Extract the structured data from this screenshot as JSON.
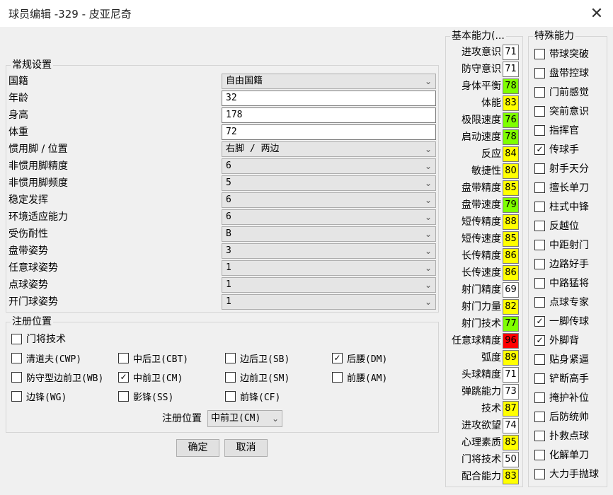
{
  "window": {
    "title": "球员编辑 -329 - 皮亚尼奇",
    "close_glyph": "✕"
  },
  "general": {
    "title": "常规设置",
    "rows": [
      {
        "label": "国籍",
        "value": "自由国籍",
        "kind": "select"
      },
      {
        "label": "年龄",
        "value": "32",
        "kind": "text"
      },
      {
        "label": "身高",
        "value": "178",
        "kind": "text"
      },
      {
        "label": "体重",
        "value": "72",
        "kind": "text"
      },
      {
        "label": "惯用脚 / 位置",
        "value": "右脚 / 两边",
        "kind": "select"
      },
      {
        "label": "非惯用脚精度",
        "value": "6",
        "kind": "select"
      },
      {
        "label": "非惯用脚频度",
        "value": "5",
        "kind": "select"
      },
      {
        "label": "稳定发挥",
        "value": "6",
        "kind": "select"
      },
      {
        "label": "环境适应能力",
        "value": "6",
        "kind": "select"
      },
      {
        "label": "受伤耐性",
        "value": "B",
        "kind": "select"
      },
      {
        "label": "盘带姿势",
        "value": "3",
        "kind": "select"
      },
      {
        "label": "任意球姿势",
        "value": "1",
        "kind": "select"
      },
      {
        "label": "点球姿势",
        "value": "1",
        "kind": "select"
      },
      {
        "label": "开门球姿势",
        "value": "1",
        "kind": "select"
      }
    ]
  },
  "positions": {
    "title": "注册位置",
    "items": [
      {
        "label": "门将技术",
        "checked": false
      },
      {
        "label": "清道夫(CWP)",
        "checked": false
      },
      {
        "label": "中后卫(CBT)",
        "checked": false
      },
      {
        "label": "边后卫(SB)",
        "checked": false
      },
      {
        "label": "后腰(DM)",
        "checked": true
      },
      {
        "label": "防守型边前卫(WB)",
        "checked": false
      },
      {
        "label": "中前卫(CM)",
        "checked": true
      },
      {
        "label": "边前卫(SM)",
        "checked": false
      },
      {
        "label": "前腰(AM)",
        "checked": false
      },
      {
        "label": "边锋(WG)",
        "checked": false
      },
      {
        "label": "影锋(SS)",
        "checked": false
      },
      {
        "label": "前锋(CF)",
        "checked": false
      }
    ],
    "register_label": "注册位置",
    "register_value": "中前卫(CM)"
  },
  "buttons": {
    "ok": "确定",
    "cancel": "取消"
  },
  "stats": {
    "title": "基本能力(...",
    "colors": {
      "green": "#7fff00",
      "yellow": "#ffff00",
      "red": "#ff0000",
      "white": "#ffffff"
    },
    "items": [
      {
        "label": "进攻意识",
        "value": "71",
        "color": "white"
      },
      {
        "label": "防守意识",
        "value": "71",
        "color": "white"
      },
      {
        "label": "身体平衡",
        "value": "78",
        "color": "green"
      },
      {
        "label": "体能",
        "value": "83",
        "color": "yellow"
      },
      {
        "label": "极限速度",
        "value": "76",
        "color": "green"
      },
      {
        "label": "启动速度",
        "value": "78",
        "color": "green"
      },
      {
        "label": "反应",
        "value": "84",
        "color": "yellow"
      },
      {
        "label": "敏捷性",
        "value": "80",
        "color": "yellow"
      },
      {
        "label": "盘带精度",
        "value": "85",
        "color": "yellow"
      },
      {
        "label": "盘带速度",
        "value": "79",
        "color": "green"
      },
      {
        "label": "短传精度",
        "value": "88",
        "color": "yellow"
      },
      {
        "label": "短传速度",
        "value": "85",
        "color": "yellow"
      },
      {
        "label": "长传精度",
        "value": "86",
        "color": "yellow"
      },
      {
        "label": "长传速度",
        "value": "86",
        "color": "yellow"
      },
      {
        "label": "射门精度",
        "value": "69",
        "color": "white"
      },
      {
        "label": "射门力量",
        "value": "82",
        "color": "yellow"
      },
      {
        "label": "射门技术",
        "value": "77",
        "color": "green"
      },
      {
        "label": "任意球精度",
        "value": "96",
        "color": "red"
      },
      {
        "label": "弧度",
        "value": "89",
        "color": "yellow"
      },
      {
        "label": "头球精度",
        "value": "71",
        "color": "white"
      },
      {
        "label": "弹跳能力",
        "value": "73",
        "color": "white"
      },
      {
        "label": "技术",
        "value": "87",
        "color": "yellow"
      },
      {
        "label": "进攻欲望",
        "value": "74",
        "color": "white"
      },
      {
        "label": "心理素质",
        "value": "85",
        "color": "yellow"
      },
      {
        "label": "门将技术",
        "value": "50",
        "color": "white"
      },
      {
        "label": "配合能力",
        "value": "83",
        "color": "yellow"
      }
    ]
  },
  "skills": {
    "title": "特殊能力",
    "items": [
      {
        "label": "带球突破",
        "checked": false
      },
      {
        "label": "盘带控球",
        "checked": false
      },
      {
        "label": "门前感觉",
        "checked": false
      },
      {
        "label": "突前意识",
        "checked": false
      },
      {
        "label": "指挥官",
        "checked": false
      },
      {
        "label": "传球手",
        "checked": true
      },
      {
        "label": "射手天分",
        "checked": false
      },
      {
        "label": "擅长单刀",
        "checked": false
      },
      {
        "label": "柱式中锋",
        "checked": false
      },
      {
        "label": "反越位",
        "checked": false
      },
      {
        "label": "中距射门",
        "checked": false
      },
      {
        "label": "边路好手",
        "checked": false
      },
      {
        "label": "中路猛将",
        "checked": false
      },
      {
        "label": "点球专家",
        "checked": false
      },
      {
        "label": "一脚传球",
        "checked": true
      },
      {
        "label": "外脚背",
        "checked": true
      },
      {
        "label": "贴身紧逼",
        "checked": false
      },
      {
        "label": "铲断高手",
        "checked": false
      },
      {
        "label": "掩护补位",
        "checked": false
      },
      {
        "label": "后防统帅",
        "checked": false
      },
      {
        "label": "扑救点球",
        "checked": false
      },
      {
        "label": "化解单刀",
        "checked": false
      },
      {
        "label": "大力手抛球",
        "checked": false
      }
    ]
  },
  "icons": {
    "dropdown": "chevron-down-icon",
    "check": "checkmark-icon",
    "close": "close-icon"
  }
}
